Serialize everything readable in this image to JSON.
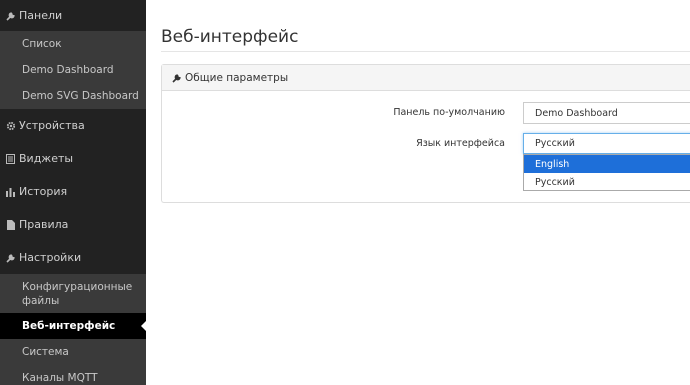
{
  "sidebar": {
    "sections": [
      {
        "label": "Панели",
        "icon": "wrench-icon"
      },
      {
        "label": "Устройства",
        "icon": "gear-icon"
      },
      {
        "label": "Виджеты",
        "icon": "list-icon"
      },
      {
        "label": "История",
        "icon": "bar-chart-icon"
      },
      {
        "label": "Правила",
        "icon": "file-icon"
      },
      {
        "label": "Настройки",
        "icon": "wrench-icon"
      }
    ],
    "panels_sub": [
      "Список",
      "Demo Dashboard",
      "Demo SVG Dashboard"
    ],
    "settings_sub": [
      "Конфигурационные файлы",
      "Веб-интерфейс",
      "Система",
      "Каналы MQTT"
    ],
    "active_item": "Веб-интерфейс"
  },
  "main": {
    "title": "Веб-интерфейс",
    "panel": {
      "heading": "Общие параметры",
      "heading_icon": "wrench-icon",
      "default_panel_label": "Панель по-умолчанию",
      "default_panel_value": "Demo Dashboard",
      "language_label": "Язык интерфейса",
      "language_value": "Русский",
      "language_options": [
        "English",
        "Русский"
      ],
      "highlighted_option": "English"
    }
  },
  "colors": {
    "sidebar_bg": "#222222",
    "submenu_bg": "#3a3a3a",
    "active_bg": "#000000",
    "highlight": "#1e6fd9"
  }
}
